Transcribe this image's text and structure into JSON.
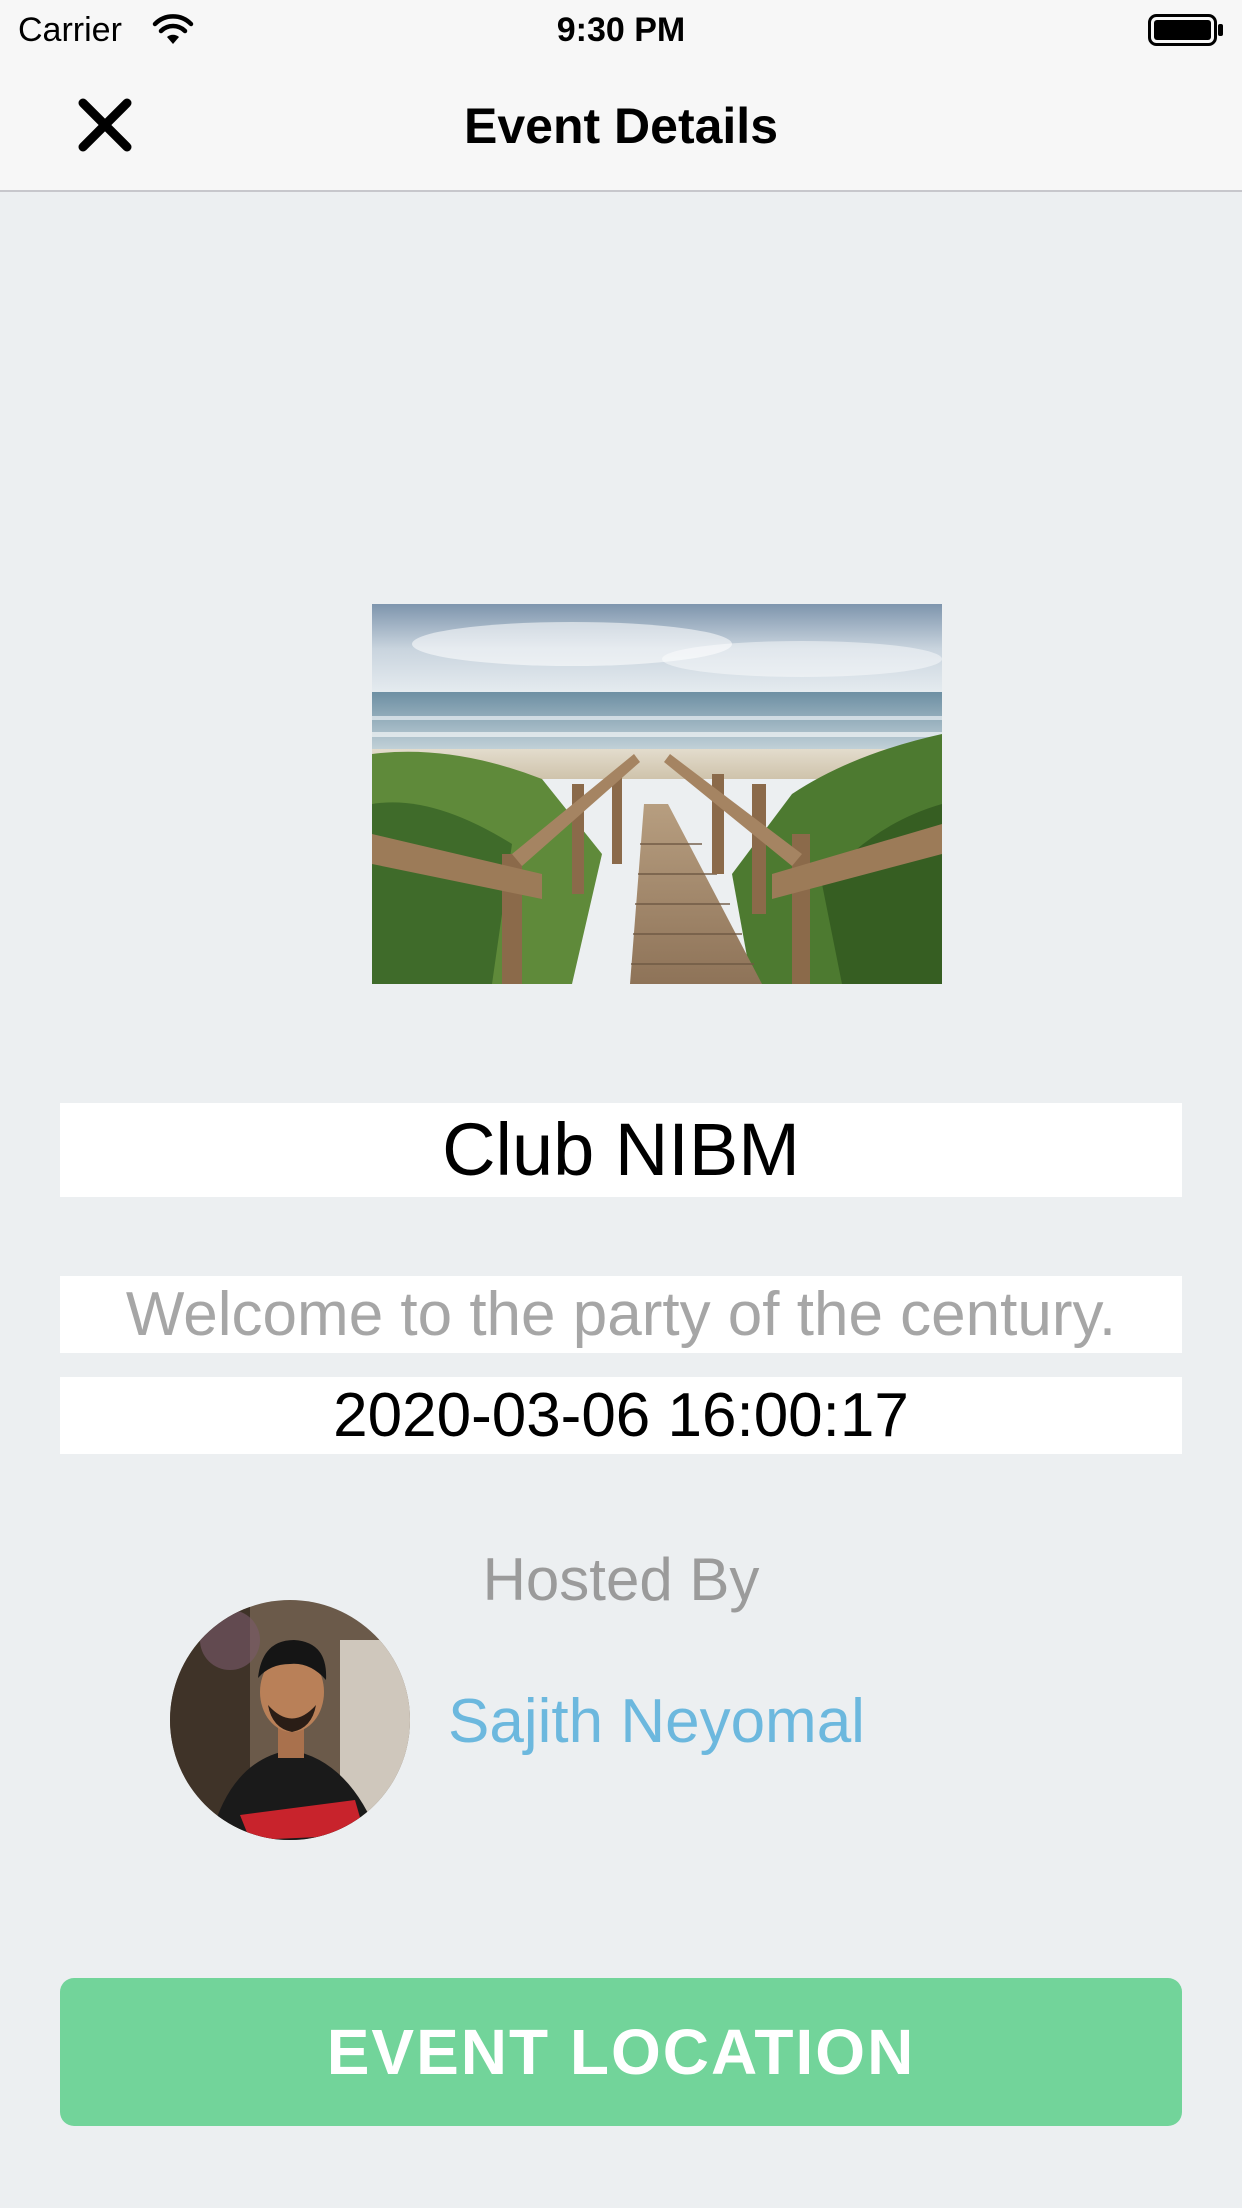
{
  "status_bar": {
    "carrier": "Carrier",
    "time": "9:30 PM"
  },
  "nav": {
    "title": "Event Details",
    "close_icon": "close-icon"
  },
  "event": {
    "title": "Club NIBM",
    "description": "Welcome to the party of the century.",
    "datetime": "2020-03-06 16:00:17"
  },
  "host": {
    "label": "Hosted By",
    "name": "Sajith Neyomal"
  },
  "actions": {
    "location_label": "EVENT LOCATION"
  },
  "colors": {
    "background": "#eceff1",
    "accent_green": "#72d49a",
    "host_link": "#6cb8de"
  }
}
